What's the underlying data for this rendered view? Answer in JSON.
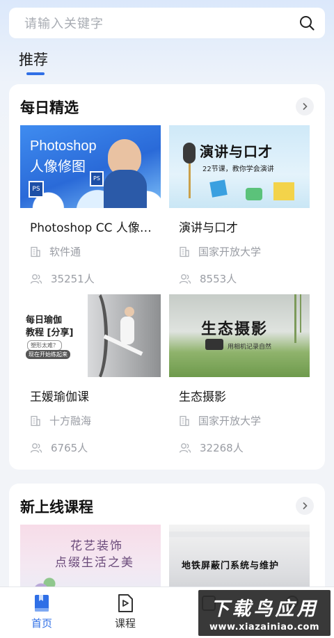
{
  "search": {
    "placeholder": "请输入关键字"
  },
  "tabs": {
    "recommend": "推荐"
  },
  "daily": {
    "title": "每日精选",
    "courses": [
      {
        "title": "Photoshop CC 人像修图",
        "provider": "软件通",
        "count": "35251人",
        "thumb_line1": "Photoshop",
        "thumb_line2": "人像修图"
      },
      {
        "title": "演讲与口才",
        "provider": "国家开放大学",
        "count": "8553人",
        "thumb_line1": "演讲与口才",
        "thumb_line2": "22节课，教你学会演讲"
      },
      {
        "title": "王媛瑜伽课",
        "provider": "十方融海",
        "count": "6765人",
        "thumb_line1": "每日瑜伽",
        "thumb_line2": "教程 [分享]",
        "thumb_tag1": "塑形太难？",
        "thumb_tag2": "现在开始练起来"
      },
      {
        "title": "生态摄影",
        "provider": "国家开放大学",
        "count": "32268人",
        "thumb_line1": "生态摄影",
        "thumb_line2": "用相机记录自然"
      }
    ]
  },
  "new_courses": {
    "title": "新上线课程",
    "courses": [
      {
        "thumb_line1": "花艺装饰",
        "thumb_line2": "点缀生活之美"
      },
      {
        "thumb_line1": "地铁屏蔽门系统与维护"
      }
    ]
  },
  "bottom_nav": [
    {
      "label": "首页",
      "icon": "home-book-icon",
      "active": true
    },
    {
      "label": "课程",
      "icon": "video-file-icon",
      "active": false
    },
    {
      "label": "",
      "icon": "hidden-nav-icon",
      "active": false
    },
    {
      "label": "",
      "icon": "hidden-nav-icon",
      "active": false
    }
  ],
  "watermark": {
    "big": "下载鸟应用",
    "small": "www.xiazainiao.com"
  },
  "colors": {
    "accent": "#2f6fe6",
    "meta": "#9a9da4"
  }
}
